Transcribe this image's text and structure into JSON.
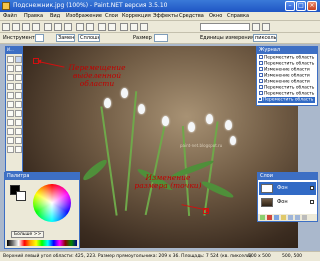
{
  "window": {
    "title": "Подснежник.jpg (100%) - Paint.NET версия 3.5.10"
  },
  "menu": {
    "items": [
      "Файл",
      "Правка",
      "Вид",
      "Изображение",
      "Слои",
      "Коррекция",
      "Эффекты",
      "Средства",
      "Окно",
      "Справка"
    ]
  },
  "toolbar": {
    "tool_label": "Инструмент:",
    "resize_label": "Размер",
    "resize_value": "",
    "units_label": "Единицы измерения:",
    "units_value": "пикселы",
    "clip_value": "Заменить",
    "fill_value": "Сплошная"
  },
  "panels": {
    "tools_title": "И...",
    "history_title": "Журнал",
    "history_items": [
      "Переместить область",
      "Переместить область",
      "Изменение области",
      "Изменение области",
      "Изменение области",
      "Переместить область",
      "Переместить область",
      "Переместить область"
    ],
    "layers_title": "Слои",
    "layers": [
      {
        "name": "Фон"
      },
      {
        "name": "Фон"
      }
    ],
    "palette_title": "Палитра",
    "palette_more": "Больше >>"
  },
  "annotations": {
    "top": "Перемещение выделенной области",
    "bottom": "Изменение размера (точки)"
  },
  "watermark": "paint-net.blogspot.ru",
  "status": {
    "text": "Верхний левый угол области: 425, 223. Размер прямоугольника: 209 x 36. Площадь: 7 524 (кв. пиксели)",
    "size": "500 x 500",
    "pos": "500, 500"
  },
  "colors": {
    "title_blue": "#1f55c4",
    "panel_border": "#3d6fc4",
    "annotation_red": "#c00000",
    "selection_blue": "#316ac5"
  }
}
